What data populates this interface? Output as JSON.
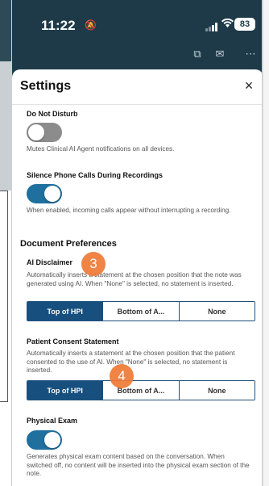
{
  "status": {
    "time": "11:22",
    "battery": "83"
  },
  "icons": {
    "bell_off": "bell-slash-icon",
    "signal": "signal-icon",
    "wifi": "wifi-icon",
    "translate": "translate-icon",
    "mail": "mail-icon",
    "more": "more-icon",
    "close": "close-icon"
  },
  "sheet": {
    "title": "Settings",
    "close_label": "×"
  },
  "settings": {
    "do_not_disturb": {
      "label": "Do Not Disturb",
      "state": "off",
      "help": "Mutes Clinical AI Agent notifications on all devices."
    },
    "silence_calls": {
      "label": "Silence Phone Calls During Recordings",
      "state": "on",
      "help": "When enabled, incoming calls appear without interrupting a recording."
    }
  },
  "document_preferences": {
    "heading": "Document Preferences",
    "ai_disclaimer": {
      "label": "AI Disclaimer",
      "help": "Automatically inserts a statement at the chosen position that the note was generated using AI. When \"None\" is selected, no statement is inserted.",
      "options": [
        "Top of HPI",
        "Bottom of A...",
        "None"
      ],
      "selected": "Top of HPI"
    },
    "patient_consent": {
      "label": "Patient Consent Statement",
      "help": "Automatically inserts a statement at the chosen position that the patient consented to the use of AI. When \"None\" is selected, no statement is inserted.",
      "options": [
        "Top of HPI",
        "Bottom of A...",
        "None"
      ],
      "selected": "Top of HPI"
    },
    "physical_exam": {
      "label": "Physical Exam",
      "state": "on",
      "help": "Generates physical exam content based on the conversation. When switched off, no content will be inserted into the physical exam section of the note."
    }
  },
  "annotations": {
    "badge_a": "3",
    "badge_b": "4",
    "color": "#ee7a36"
  },
  "colors": {
    "header_bg": "#1e3a49",
    "accent": "#174f7e",
    "toggle_on": "#1f6f9f",
    "toggle_off": "#8c8c8c"
  }
}
